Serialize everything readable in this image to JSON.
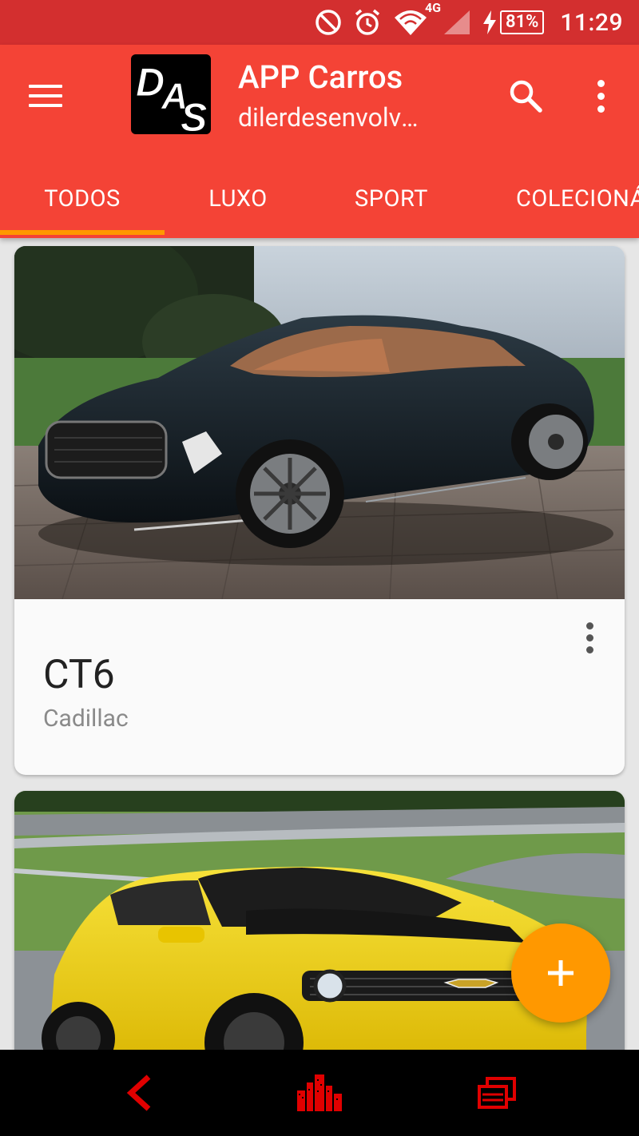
{
  "status_bar": {
    "network_type": "4G",
    "battery_percent": "81%",
    "time": "11:29",
    "icons": [
      "dnd-icon",
      "alarm-icon",
      "wifi-icon",
      "signal-icon",
      "charging-icon",
      "battery-icon"
    ]
  },
  "app_bar": {
    "logo_text": "DAS",
    "title": "APP Carros",
    "subtitle": "dilerdesenvolvimento",
    "actions": [
      "search-icon",
      "more-vert-icon"
    ]
  },
  "tabs": [
    {
      "label": "TODOS",
      "selected": true
    },
    {
      "label": "LUXO",
      "selected": false
    },
    {
      "label": "SPORT",
      "selected": false
    },
    {
      "label": "COLECIONÁVEIS",
      "selected": false
    }
  ],
  "cars": [
    {
      "name": "CT6",
      "brand": "Cadillac",
      "image": "black-cadillac-coupe"
    },
    {
      "name": "",
      "brand": "",
      "image": "yellow-chevrolet-camaro"
    }
  ],
  "fab": {
    "icon": "plus-icon"
  },
  "colors": {
    "status_bar": "#d32f2f",
    "primary": "#f44336",
    "accent": "#ff9800",
    "nav_icons": "#e00000"
  }
}
